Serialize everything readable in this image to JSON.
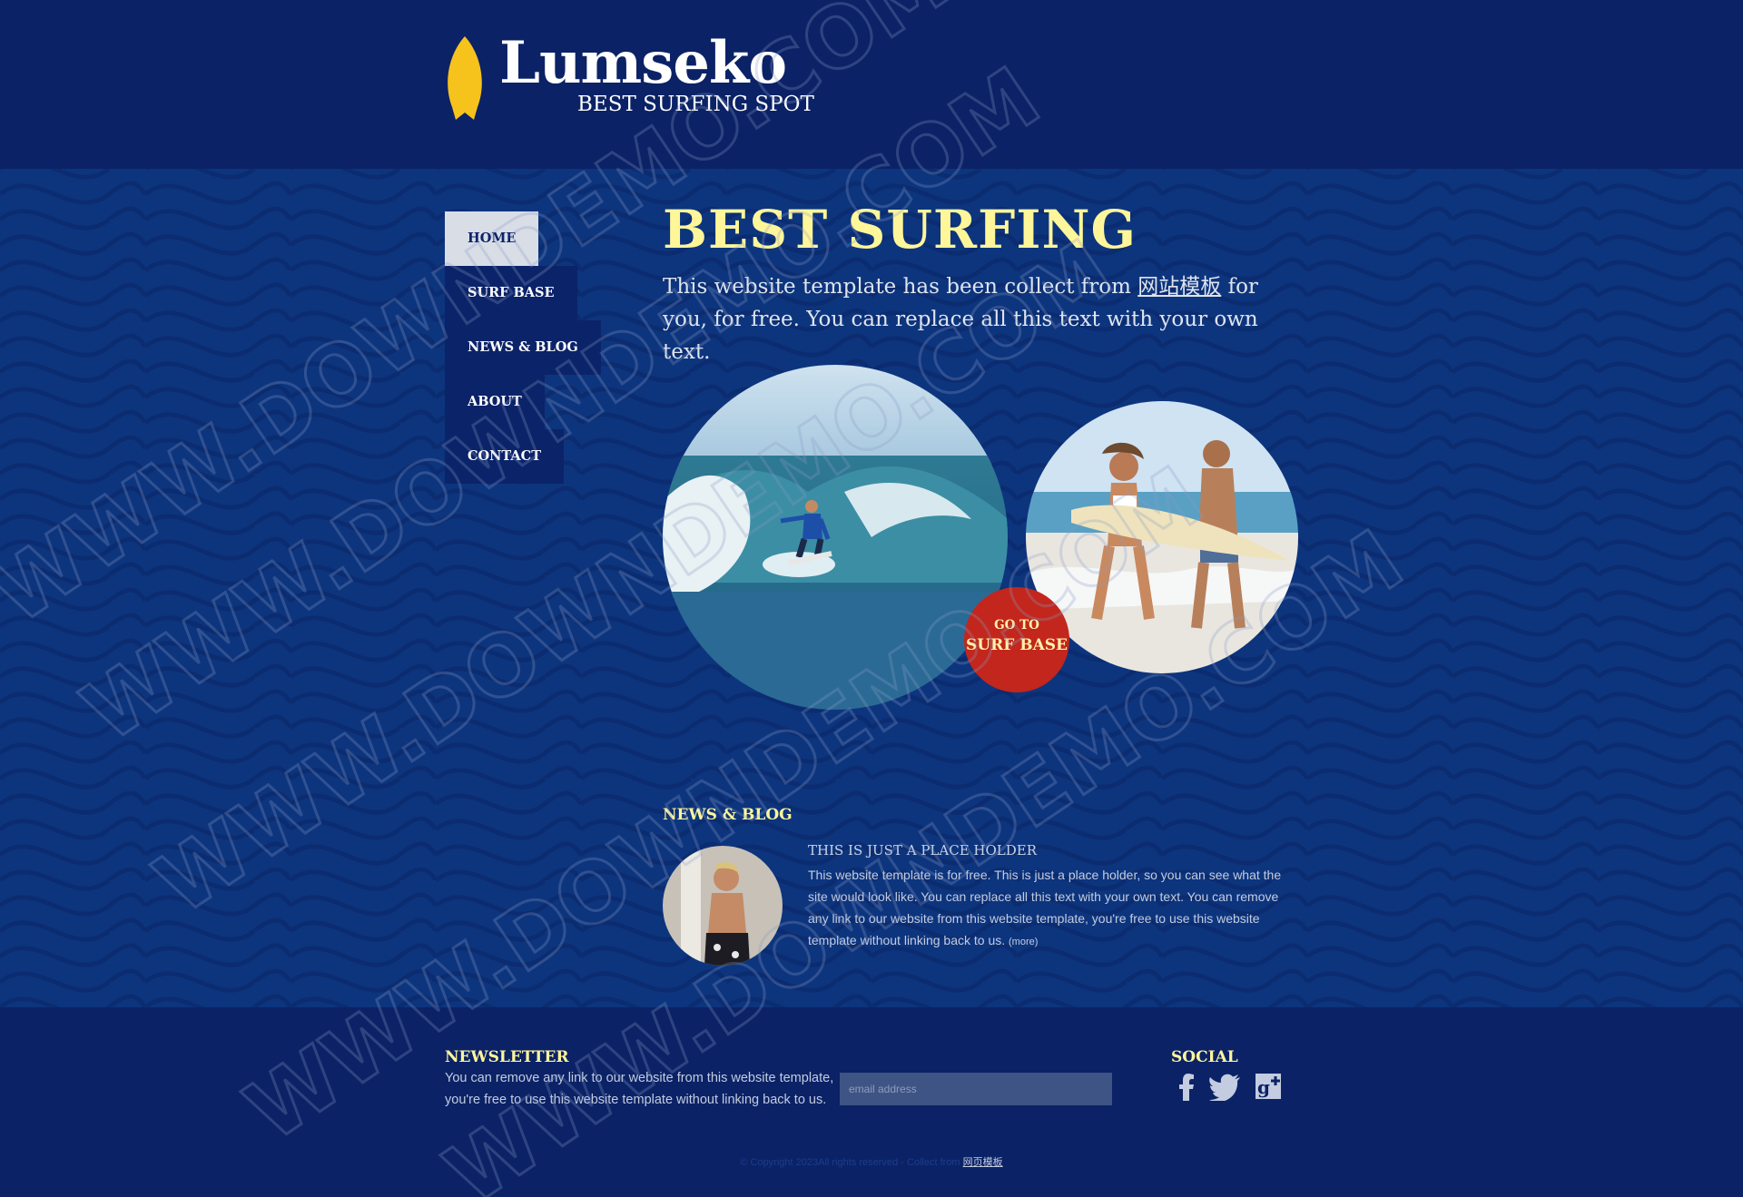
{
  "brand": {
    "name": "Lumseko",
    "tagline": "BEST SURFING  SPOT"
  },
  "nav": {
    "items": [
      {
        "label": "HOME",
        "active": true
      },
      {
        "label": "SURF BASE",
        "active": false
      },
      {
        "label": "NEWS & BLOG",
        "active": false
      },
      {
        "label": "ABOUT",
        "active": false
      },
      {
        "label": "CONTACT",
        "active": false
      }
    ]
  },
  "hero": {
    "title": "BEST SURFING",
    "text_before": "This website template has been collect from ",
    "link": "网站模板",
    "text_after": " for you, for free. You can replace all this text with your own text."
  },
  "cta": {
    "small": "GO TO",
    "big": "SURF BASE"
  },
  "news": {
    "heading": "NEWS & BLOG",
    "post_title": "THIS IS JUST A PLACE HOLDER",
    "post_body": "This website template is for free. This is just a place holder, so you can see what the site would look like. You can replace all this text with your own text. You can remove any link to our website from this website template, you're free to use this website template without linking back to us. ",
    "more_label": "(more)"
  },
  "footer": {
    "newsletter_heading": "NEWSLETTER",
    "newsletter_text": "You can remove any link to our website from this website template, you're free to use this website template without linking back to us.",
    "email_placeholder": "email address",
    "social_heading": "SOCIAL",
    "copyright": "© Copyright 2023All rights reserved - Collect from ",
    "copyright_link": "网页模板"
  },
  "watermark": "WWW.DOWNDEMO.COM",
  "colors": {
    "header_bg": "#0b2266",
    "main_bg": "#0d357e",
    "accent_yellow": "#fff69a",
    "cta_red": "#c3261c",
    "board_yellow": "#f6c21c"
  }
}
